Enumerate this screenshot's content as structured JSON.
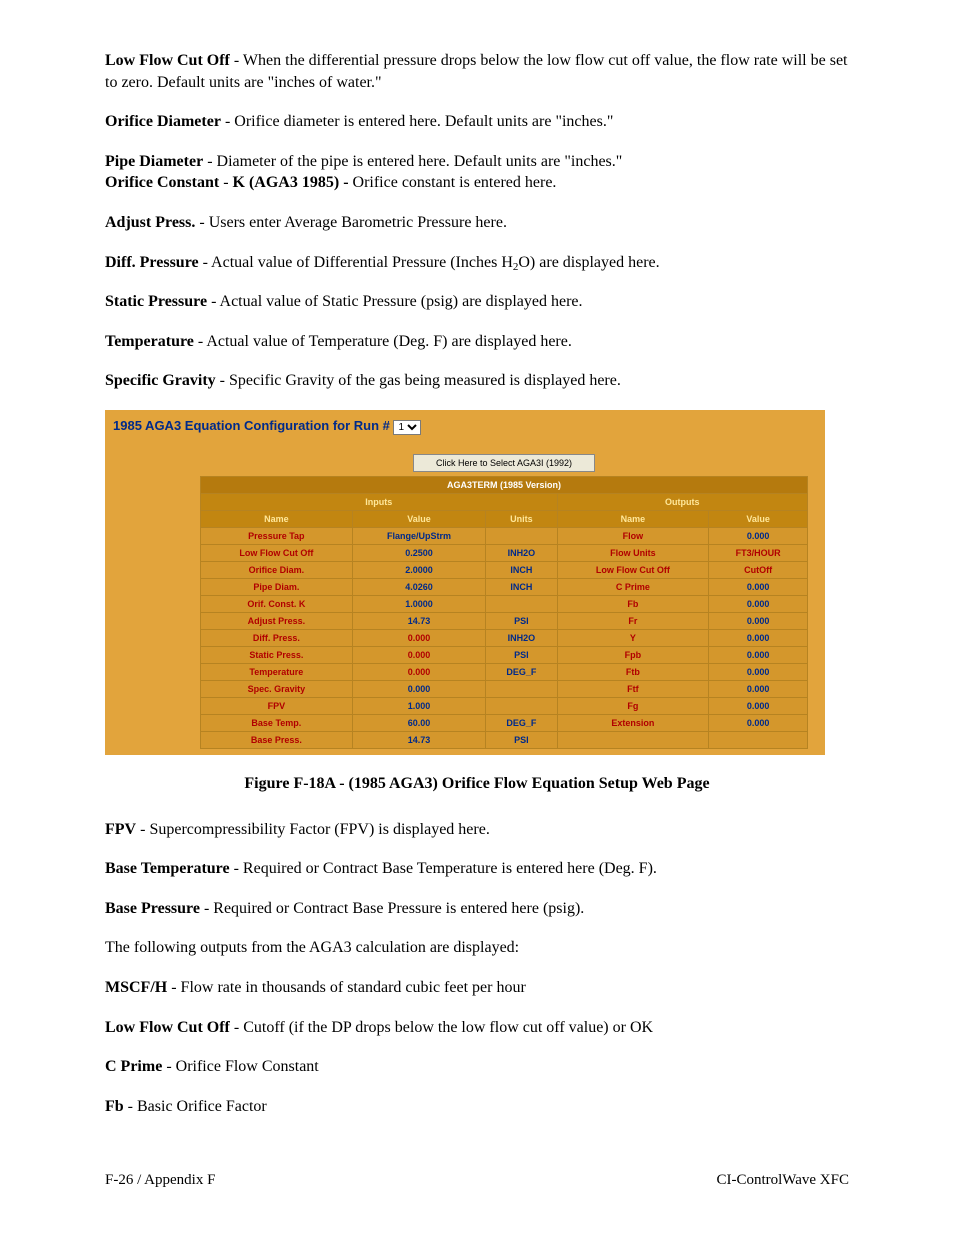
{
  "defs": [
    {
      "term": "Low Flow Cut Off",
      "text": " - When the differential pressure drops below the low flow cut off value, the flow rate will be set to zero. Default units are \"inches of water.\""
    },
    {
      "term": "Orifice Diameter",
      "text": " - Orifice diameter is entered here. Default units are \"inches.\""
    }
  ],
  "pipe": {
    "term1": "Pipe Diameter",
    "text1": " - Diameter of the pipe is entered here. Default units are \"inches.\"",
    "term2": "Orifice Constant",
    "sep": " - ",
    "term3": "K (AGA3 1985) - ",
    "text2": "Orifice constant is entered here."
  },
  "defs2": [
    {
      "term": "Adjust Press.",
      "text": " - Users enter Average Barometric Pressure here."
    }
  ],
  "diffp": {
    "term": "Diff. Pressure",
    "pre": " - Actual value of Differential Pressure (Inches H",
    "sub": "2",
    "post": "O) are displayed here."
  },
  "defs3": [
    {
      "term": "Static Pressure",
      "text": "  - Actual value of  Static Pressure (psig) are displayed here."
    },
    {
      "term": "Temperature",
      "text": " - Actual value of  Temperature (Deg. F) are displayed here."
    },
    {
      "term": "Specific Gravity",
      "text": " - Specific Gravity of the gas being measured is displayed here."
    }
  ],
  "figure": {
    "title": "1985 AGA3 Equation Configuration for Run # ",
    "run": "1",
    "button": "Click Here to Select AGA3I (1992)",
    "version": "AGA3TERM (1985 Version)",
    "inputs_hdr": "Inputs",
    "outputs_hdr": "Outputs",
    "cols": {
      "name": "Name",
      "value": "Value",
      "units": "Units"
    },
    "rows": [
      {
        "n": "Pressure Tap",
        "v": "Flange/UpStrm",
        "vc": "b",
        "u": "",
        "on": "Flow",
        "ov": "0.000",
        "oc": "b"
      },
      {
        "n": "Low Flow Cut Off",
        "v": "0.2500",
        "vc": "b",
        "u": "INH2O",
        "on": "Flow Units",
        "ov": "FT3/HOUR",
        "oc": "r"
      },
      {
        "n": "Orifice Diam.",
        "v": "2.0000",
        "vc": "b",
        "u": "INCH",
        "on": "Low Flow Cut Off",
        "ov": "CutOff",
        "oc": "r"
      },
      {
        "n": "Pipe Diam.",
        "v": "4.0260",
        "vc": "b",
        "u": "INCH",
        "on": "C Prime",
        "ov": "0.000",
        "oc": "b"
      },
      {
        "n": "Orif. Const. K",
        "v": "1.0000",
        "vc": "b",
        "u": "",
        "on": "Fb",
        "ov": "0.000",
        "oc": "b"
      },
      {
        "n": "Adjust Press.",
        "v": "14.73",
        "vc": "b",
        "u": "PSI",
        "on": "Fr",
        "ov": "0.000",
        "oc": "b"
      },
      {
        "n": "Diff. Press.",
        "v": "0.000",
        "vc": "r",
        "u": "INH2O",
        "on": "Y",
        "ov": "0.000",
        "oc": "b"
      },
      {
        "n": "Static Press.",
        "v": "0.000",
        "vc": "r",
        "u": "PSI",
        "on": "Fpb",
        "ov": "0.000",
        "oc": "b"
      },
      {
        "n": "Temperature",
        "v": "0.000",
        "vc": "r",
        "u": "DEG_F",
        "on": "Ftb",
        "ov": "0.000",
        "oc": "b"
      },
      {
        "n": "Spec. Gravity",
        "v": "0.000",
        "vc": "b",
        "u": "",
        "on": "Ftf",
        "ov": "0.000",
        "oc": "b"
      },
      {
        "n": "FPV",
        "v": "1.000",
        "vc": "b",
        "u": "",
        "on": "Fg",
        "ov": "0.000",
        "oc": "b"
      },
      {
        "n": "Base Temp.",
        "v": "60.00",
        "vc": "b",
        "u": "DEG_F",
        "on": "Extension",
        "ov": "0.000",
        "oc": "b"
      },
      {
        "n": "Base Press.",
        "v": "14.73",
        "vc": "b",
        "u": "PSI",
        "on": "",
        "ov": "",
        "oc": ""
      }
    ]
  },
  "caption": "Figure F-18A - (1985 AGA3) Orifice Flow Equation Setup Web Page",
  "defs4": [
    {
      "term": "FPV",
      "text": " - Supercompressibility Factor (FPV) is displayed here."
    },
    {
      "term": "Base Temperature",
      "text": " - Required or Contract Base Temperature is entered here (Deg. F)."
    },
    {
      "term": "Base Pressure",
      "text": " - Required or Contract Base Pressure is entered here (psig)."
    }
  ],
  "outro": "The following outputs from the AGA3 calculation are displayed:",
  "defs5": [
    {
      "term": "MSCF/H",
      "text": " - Flow rate in thousands of standard cubic feet per hour"
    },
    {
      "term": "Low Flow Cut Off",
      "text": " - Cutoff (if the DP drops below the low flow cut off value) or OK"
    },
    {
      "term": "C Prime",
      "text": " - Orifice Flow Constant"
    },
    {
      "term": "Fb",
      "text": " - Basic Orifice Factor"
    }
  ],
  "footer": {
    "left": "F-26 / Appendix F",
    "right": "CI-ControlWave XFC"
  }
}
